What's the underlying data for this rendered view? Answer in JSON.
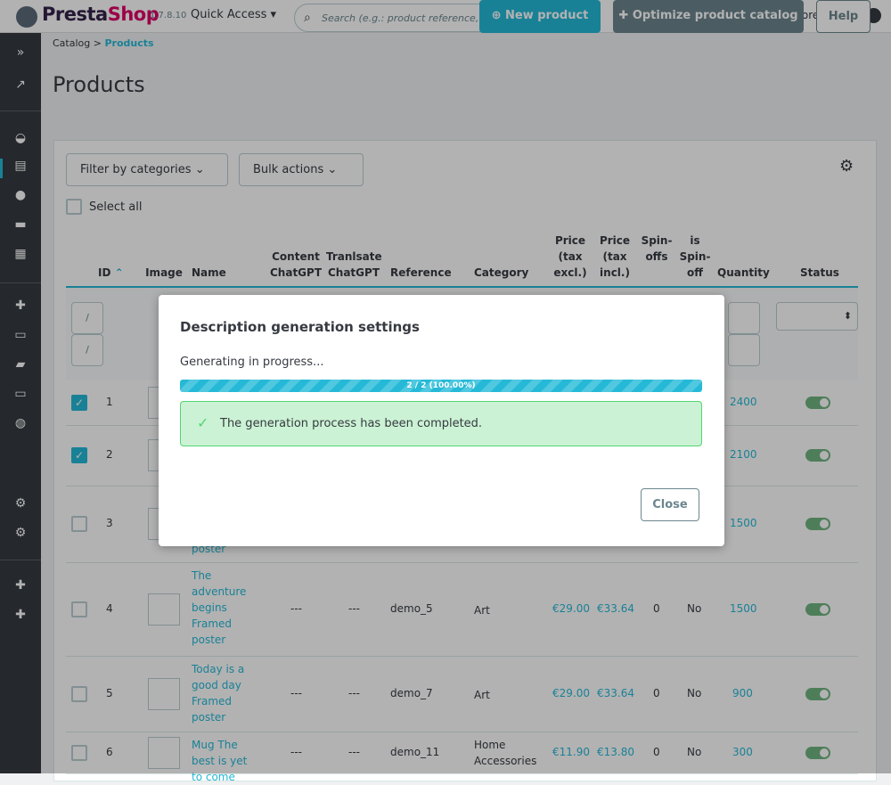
{
  "header": {
    "brand_a": "Presta",
    "brand_b": "Shop",
    "version": "1.7.8.10",
    "quick_access": "Quick Access ▾",
    "search_placeholder": "Search (e.g.: product reference, custon",
    "view_store": "View my store"
  },
  "breadcrumb": {
    "parent": "Catalog",
    "sep": ">",
    "current": "Products"
  },
  "page": {
    "title": "Products",
    "new_product": "New product",
    "optimize": "Optimize product catalog",
    "help": "Help"
  },
  "toolbar": {
    "filter": "Filter by categories",
    "bulk": "Bulk actions",
    "select_all": "Select all"
  },
  "columns": {
    "id": "ID",
    "image": "Image",
    "name": "Name",
    "content": "Content ChatGPT",
    "translate": "Tranlsate ChatGPT",
    "reference": "Reference",
    "category": "Category",
    "price_excl": "Price (tax excl.)",
    "price_incl": "Price (tax incl.)",
    "spinoffs": "Spin-offs",
    "is_spinoff": "is Spin-off",
    "quantity": "Quantity",
    "status": "Status"
  },
  "rows": [
    {
      "id": "1",
      "checked": true,
      "quantity": "2400",
      "status": true
    },
    {
      "id": "2",
      "checked": true,
      "quantity": "2100",
      "status": true
    },
    {
      "id": "3",
      "checked": false,
      "name": "poster",
      "quantity": "1500",
      "status": true
    },
    {
      "id": "4",
      "checked": false,
      "name": "The adventure begins Framed poster",
      "content": "---",
      "translate": "---",
      "reference": "demo_5",
      "category": "Art",
      "price_excl": "€29.00",
      "price_incl": "€33.64",
      "spinoffs": "0",
      "is_spinoff": "No",
      "quantity": "1500",
      "status": true
    },
    {
      "id": "5",
      "checked": false,
      "name": "Today is a good day Framed poster",
      "content": "---",
      "translate": "---",
      "reference": "demo_7",
      "category": "Art",
      "price_excl": "€29.00",
      "price_incl": "€33.64",
      "spinoffs": "0",
      "is_spinoff": "No",
      "quantity": "900",
      "status": true
    },
    {
      "id": "6",
      "checked": false,
      "name": "Mug The best is yet to come",
      "content": "---",
      "translate": "---",
      "reference": "demo_11",
      "category": "Home Accessories",
      "price_excl": "€11.90",
      "price_incl": "€13.80",
      "spinoffs": "0",
      "is_spinoff": "No",
      "quantity": "300",
      "status": true
    }
  ],
  "modal": {
    "title": "Description generation settings",
    "status": "Generating in progress...",
    "progress_label": "2 / 2 (100.00%)",
    "progress": 1.0,
    "success": "The generation process has been completed.",
    "close": "Close"
  },
  "colors": {
    "accent": "#25b9d7",
    "sidebar": "#363a41",
    "success": "#53d572"
  }
}
